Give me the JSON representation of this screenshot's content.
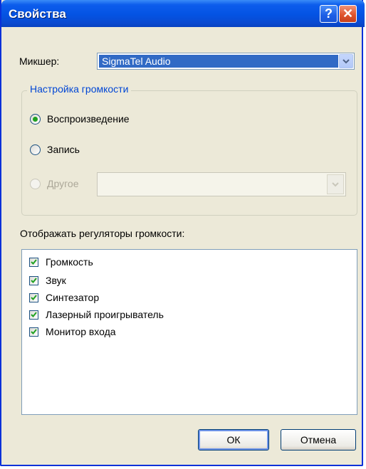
{
  "window": {
    "title": "Свойства"
  },
  "titlebar": {
    "help_glyph": "?",
    "close_glyph": "✕"
  },
  "mixer": {
    "label": "Микшер:",
    "value": "SigmaTel Audio"
  },
  "volume_group": {
    "title": "Настройка громкости",
    "options": [
      {
        "label": "Воспроизведение",
        "selected": true,
        "enabled": true
      },
      {
        "label": "Запись",
        "selected": false,
        "enabled": true
      },
      {
        "label": "Другое",
        "selected": false,
        "enabled": false
      }
    ],
    "other_combo_value": ""
  },
  "controls_list": {
    "label": "Отображать регуляторы громкости:",
    "items": [
      {
        "label": "Громкость",
        "checked": true
      },
      {
        "label": "Звук",
        "checked": true
      },
      {
        "label": "Синтезатор",
        "checked": true
      },
      {
        "label": "Лазерный проигрыватель",
        "checked": true
      },
      {
        "label": "Монитор входа",
        "checked": true
      }
    ]
  },
  "buttons": {
    "ok": "ОК",
    "cancel": "Отмена"
  },
  "colors": {
    "accent": "#0831d9",
    "selection": "#316ac5",
    "check": "#21a121"
  }
}
